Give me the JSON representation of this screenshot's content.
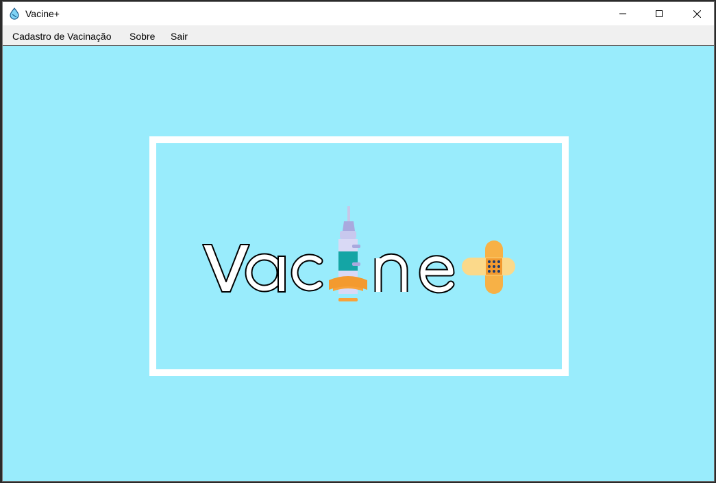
{
  "window": {
    "title": "Vacine+",
    "icon": "vaccine-drop-icon",
    "controls": [
      "minimize-icon",
      "maximize-icon",
      "close-icon"
    ]
  },
  "menu": {
    "items": [
      {
        "label": "Cadastro de Vacinação"
      },
      {
        "label": "Sobre"
      },
      {
        "label": "Sair"
      }
    ]
  },
  "logo": {
    "name": "Vacine+",
    "icons": [
      "syringe-icon",
      "bandage-plus-icon"
    ]
  },
  "colors": {
    "background": "#99ecfc",
    "frame": "#ffffff",
    "menubar": "#f0f0f0"
  }
}
